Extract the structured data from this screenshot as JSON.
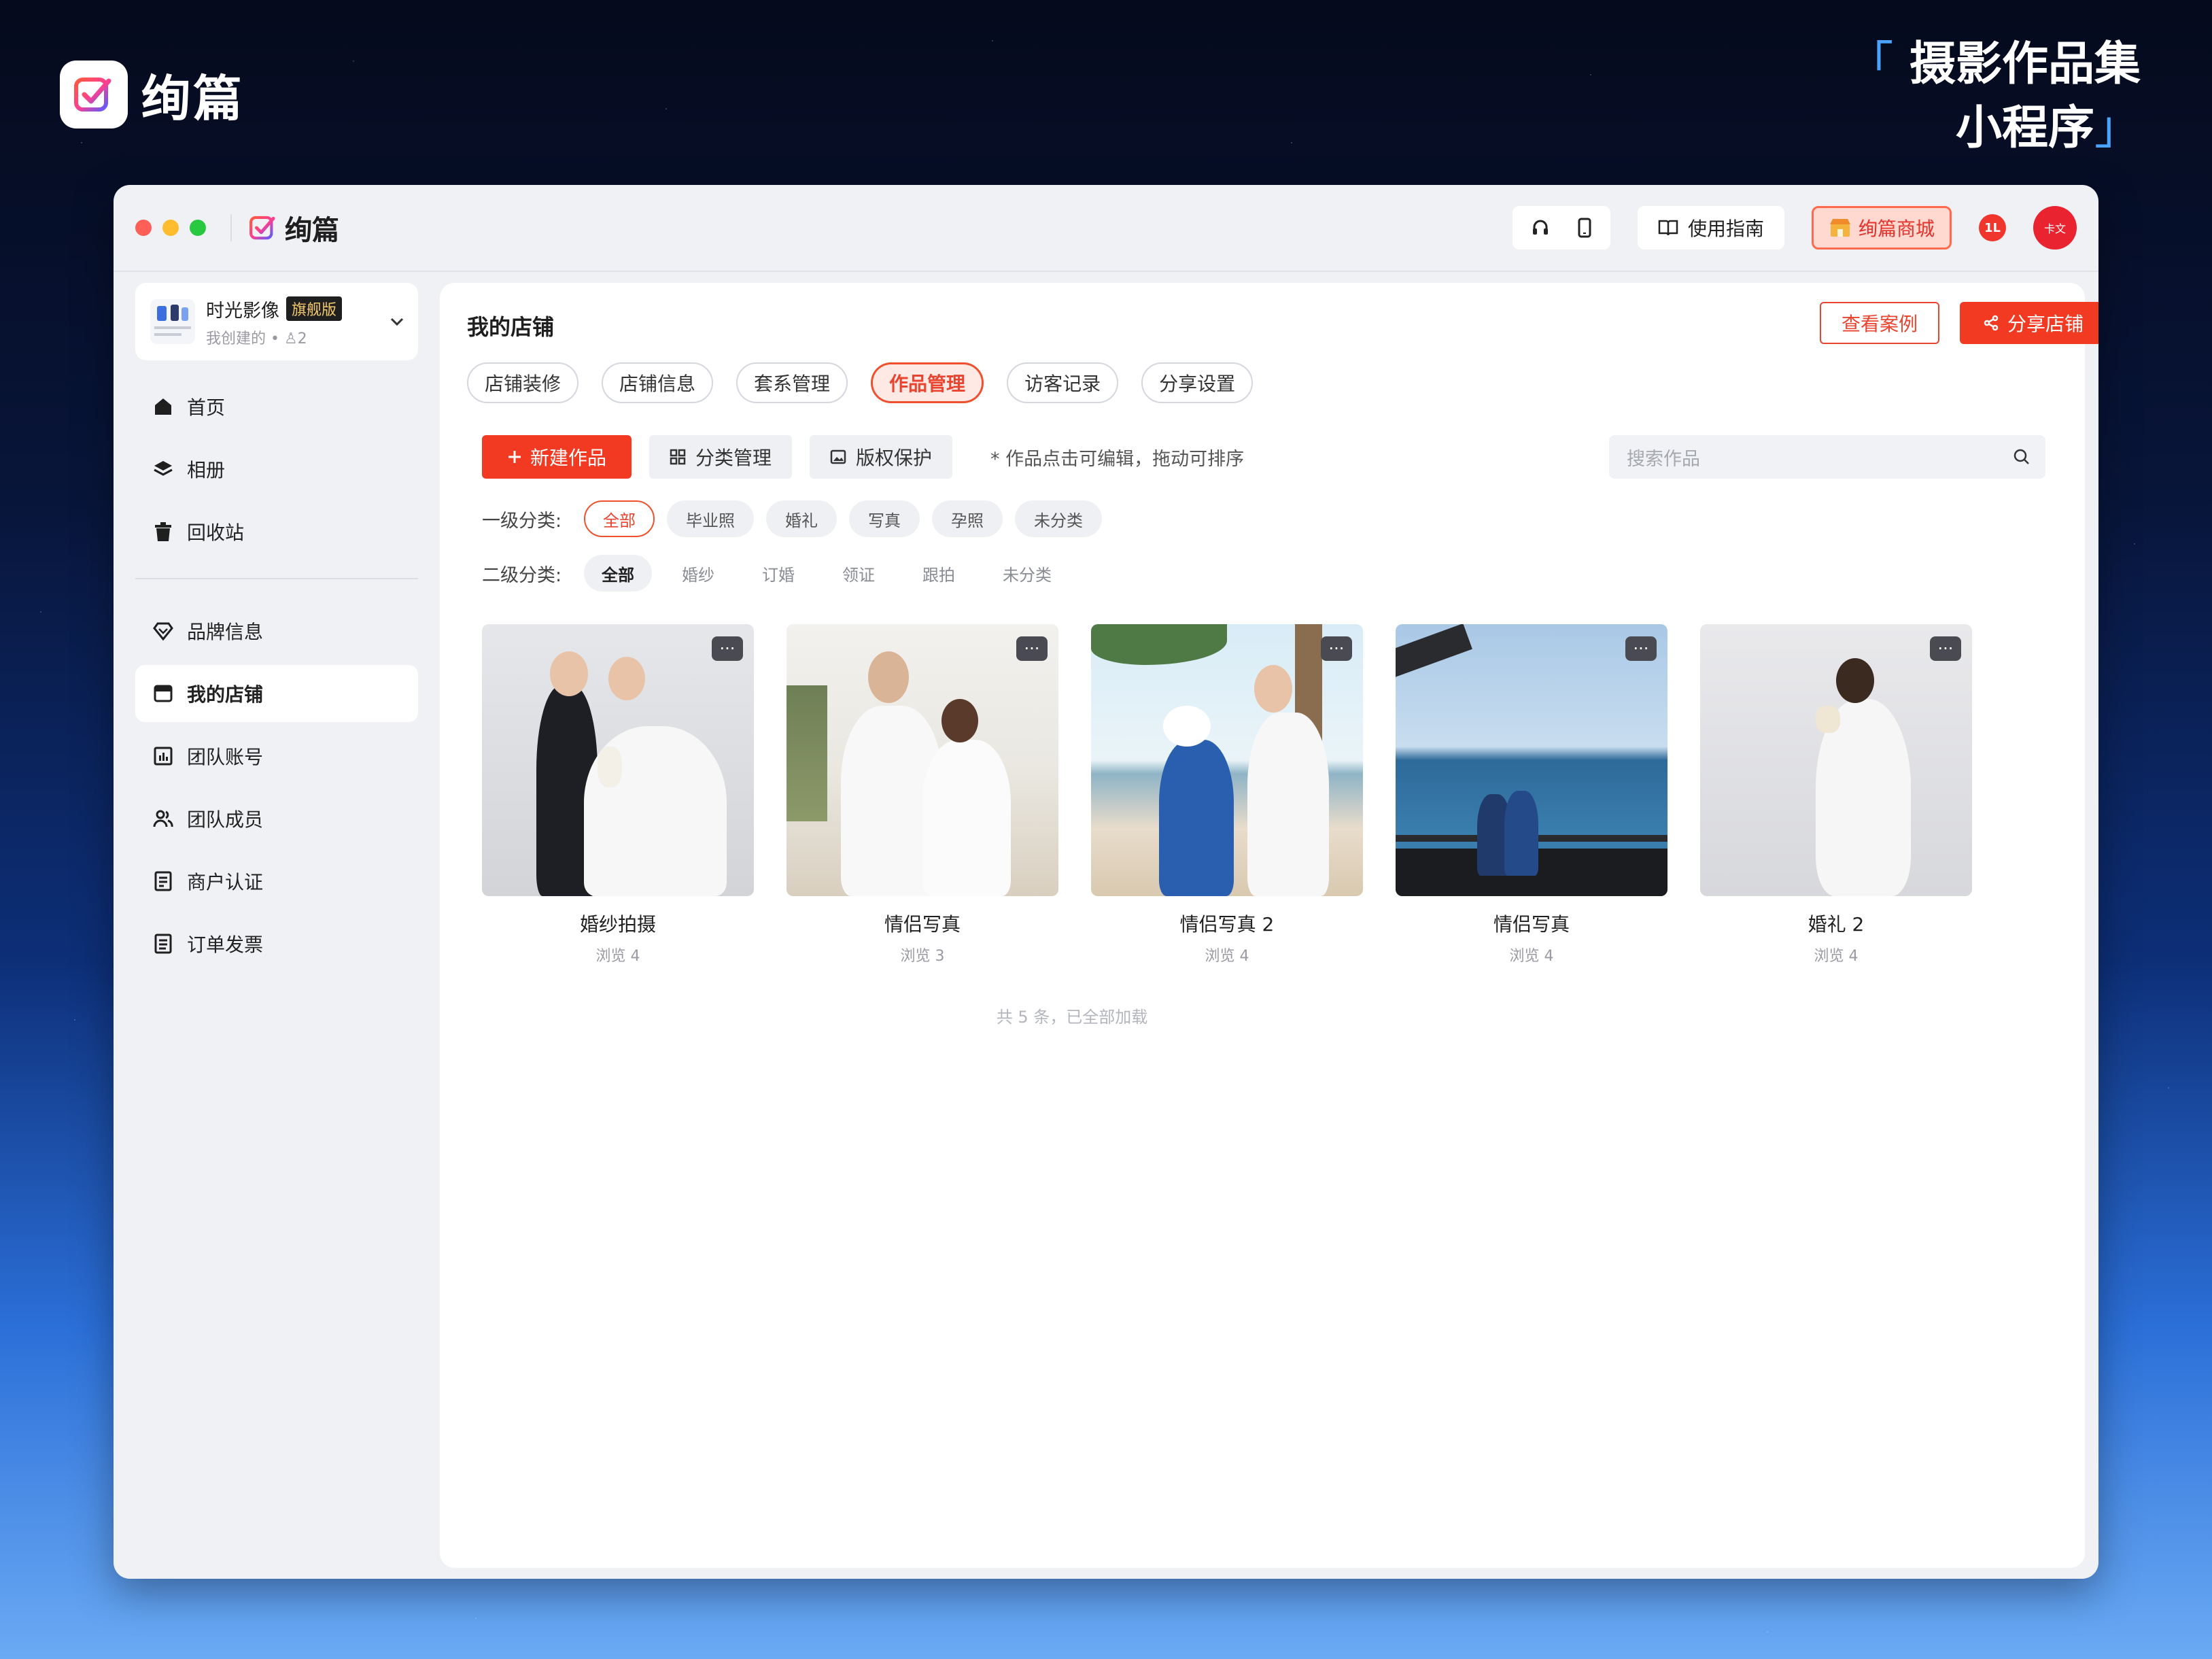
{
  "brand": {
    "name": "绚篇"
  },
  "corner_title": {
    "line1": "摄影作品集",
    "line2": "小程序",
    "open_bracket": "「",
    "close_bracket": "」"
  },
  "window": {
    "app_name": "绚篇",
    "toolbar": {
      "guide_label": "使用指南",
      "mall_label": "绚篇商城",
      "badge_text": "1L",
      "avatar_text": "卡文"
    }
  },
  "sidebar": {
    "store": {
      "name": "时光影像",
      "tag": "旗舰版",
      "subtitle": "我创建的 • ♙2"
    },
    "menu_top": [
      {
        "label": "首页",
        "icon": "home-icon"
      },
      {
        "label": "相册",
        "icon": "layers-icon"
      },
      {
        "label": "回收站",
        "icon": "trash-icon"
      }
    ],
    "menu_bottom": [
      {
        "label": "品牌信息",
        "icon": "diamond-icon"
      },
      {
        "label": "我的店铺",
        "icon": "store-icon",
        "active": true
      },
      {
        "label": "团队账号",
        "icon": "chart-icon"
      },
      {
        "label": "团队成员",
        "icon": "users-icon"
      },
      {
        "label": "商户认证",
        "icon": "document-icon"
      },
      {
        "label": "订单发票",
        "icon": "invoice-icon"
      }
    ]
  },
  "main": {
    "title": "我的店铺",
    "view_cases_label": "查看案例",
    "share_store_label": "分享店铺",
    "tabs": [
      "店铺装修",
      "店铺信息",
      "套系管理",
      "作品管理",
      "访客记录",
      "分享设置"
    ],
    "active_tab": "作品管理",
    "new_work_label": "新建作品",
    "category_mgmt_label": "分类管理",
    "copyright_label": "版权保护",
    "hint": "* 作品点击可编辑，拖动可排序",
    "search_placeholder": "搜索作品",
    "filter1_label": "一级分类:",
    "filter1_options": [
      "全部",
      "毕业照",
      "婚礼",
      "写真",
      "孕照",
      "未分类"
    ],
    "filter2_label": "二级分类:",
    "filter2_options": [
      "全部",
      "婚纱",
      "订婚",
      "领证",
      "跟拍",
      "未分类"
    ],
    "works": [
      {
        "title": "婚纱拍摄",
        "views": "浏览 4"
      },
      {
        "title": "情侣写真",
        "views": "浏览 3"
      },
      {
        "title": "情侣写真 2",
        "views": "浏览 4"
      },
      {
        "title": "情侣写真",
        "views": "浏览 4"
      },
      {
        "title": "婚礼 2",
        "views": "浏览 4"
      }
    ],
    "more_label": "···",
    "footer_note": "共 5 条，已全部加载"
  },
  "colors": {
    "accent": "#f23a22",
    "accent_light": "#ffe9e4",
    "sidebar_bg": "#f0f1f5"
  }
}
